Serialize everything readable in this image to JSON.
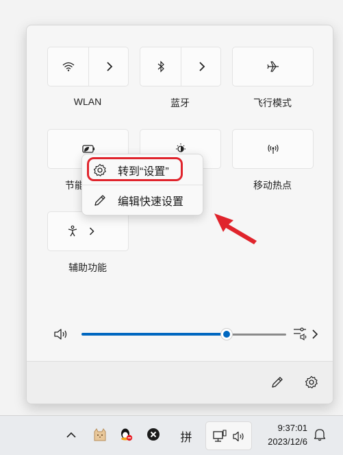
{
  "quick_settings": {
    "tiles": [
      {
        "id": "wlan",
        "label": "WLAN",
        "icon": "wifi-icon",
        "split": true
      },
      {
        "id": "bluetooth",
        "label": "蓝牙",
        "icon": "bluetooth-icon",
        "split": true
      },
      {
        "id": "airplane",
        "label": "飞行模式",
        "icon": "airplane-icon",
        "split": false
      },
      {
        "id": "battery-saver",
        "label": "节能",
        "icon": "battery-saver-icon",
        "split": false
      },
      {
        "id": "night-light",
        "label": "",
        "icon": "brightness-icon",
        "split": false
      },
      {
        "id": "hotspot",
        "label": "移动热点",
        "icon": "hotspot-icon",
        "split": false
      },
      {
        "id": "accessibility",
        "label": "辅助功能",
        "icon": "accessibility-icon",
        "split": true
      }
    ],
    "volume": {
      "level_percent": 71,
      "accent_color": "#0067c0",
      "track_color": "#8a8a8a"
    },
    "footer": {
      "edit_icon": "pencil-icon",
      "settings_icon": "gear-icon"
    }
  },
  "context_menu": {
    "items": [
      {
        "label": "转到“设置”",
        "icon": "gear-icon",
        "highlighted": true
      },
      {
        "label": "编辑快速设置",
        "icon": "pencil-icon",
        "highlighted": false
      }
    ],
    "highlight_color": "#e0242c"
  },
  "annotation_arrow": {
    "color": "#e0242c"
  },
  "taskbar": {
    "ime_label": "拼",
    "clock": {
      "time": "9:37:01",
      "date": "2023/12/6"
    }
  }
}
